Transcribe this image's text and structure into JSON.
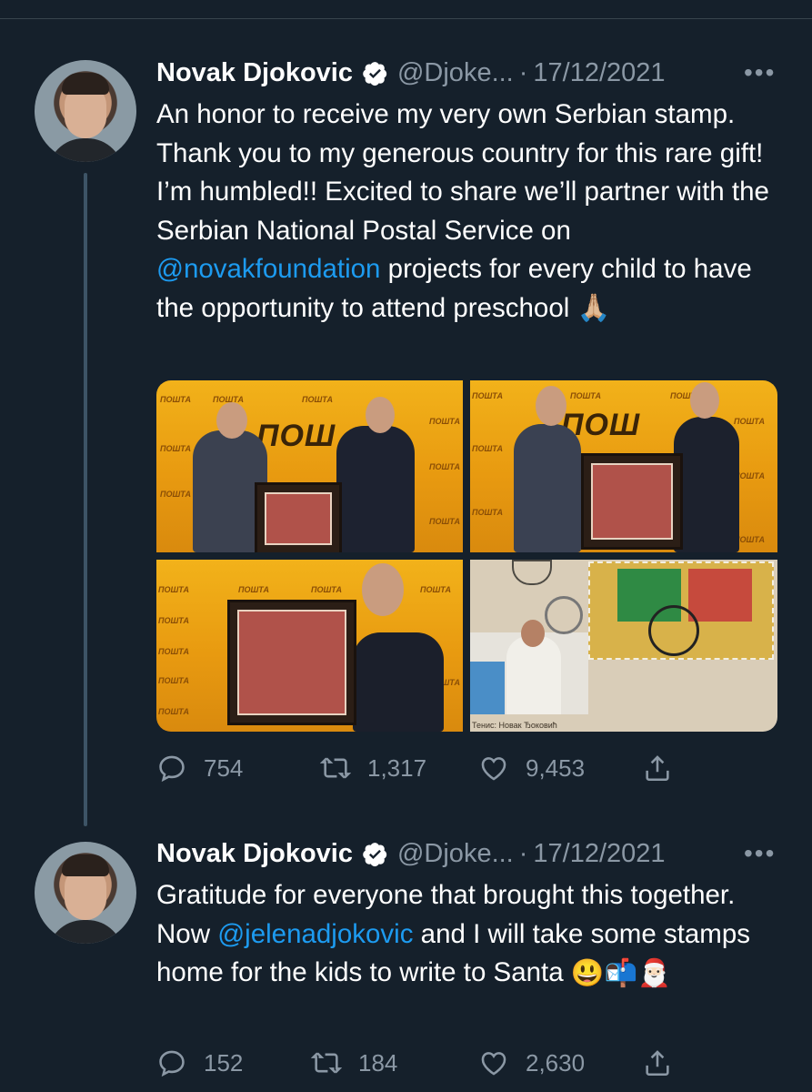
{
  "tweets": [
    {
      "author": "Novak Djokovic",
      "handle": "@Djoke...",
      "separator": "·",
      "date": "17/12/2021",
      "more": "•••",
      "text_parts": [
        "An honor to receive my very own Serbian stamp. Thank you to my generous country for this rare gift! I’m humbled!! Excited to share we’ll partner with the Serbian National Postal Service on ",
        "@novakfoundation",
        " projects for every child to have the opportunity to attend preschool"
      ],
      "emoji": "🙏🏼",
      "media": {
        "brand_text": "ПОШТА",
        "big_brand": "ПОШ",
        "stamp_caption": "Тенис: Новак Ђоковић"
      },
      "stats": {
        "replies": "754",
        "retweets": "1,317",
        "likes": "9,453"
      }
    },
    {
      "author": "Novak Djokovic",
      "handle": "@Djoke...",
      "separator": "·",
      "date": "17/12/2021",
      "more": "•••",
      "text_parts": [
        "Gratitude for everyone that brought this together. Now ",
        "@jelenadjokovic",
        " and I will take some stamps home for the kids to write to Santa"
      ],
      "emoji": "😃📬🎅🏻",
      "stats": {
        "replies": "152",
        "retweets": "184",
        "likes": "2,630"
      }
    }
  ],
  "icons": [
    "verified-badge-icon",
    "reply-icon",
    "retweet-icon",
    "like-icon",
    "share-icon",
    "more-icon"
  ],
  "colors": {
    "background": "#15202b",
    "text": "#ffffff",
    "muted": "#8b98a5",
    "link": "#1d9bf0",
    "verified": "#ffffff"
  }
}
